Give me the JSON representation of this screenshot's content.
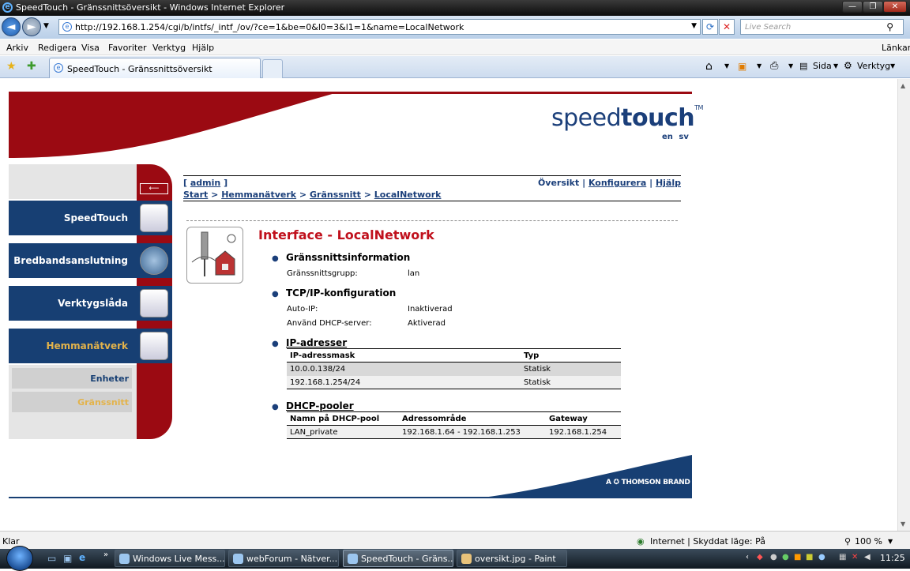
{
  "window": {
    "title": "SpeedTouch - Gränssnittsöversikt - Windows Internet Explorer",
    "minimize": "—",
    "restore": "❐",
    "close": "✕"
  },
  "browser": {
    "url": "http://192.168.1.254/cgi/b/intfs/_intf_/ov/?ce=1&be=0&l0=3&l1=1&name=LocalNetwork",
    "search_placeholder": "Live Search",
    "menu": [
      "Arkiv",
      "Redigera",
      "Visa",
      "Favoriter",
      "Verktyg",
      "Hjälp"
    ],
    "links_label": "Länkar",
    "tab_title": "SpeedTouch - Gränssnittsöversikt",
    "cmd_page": "Sida",
    "cmd_tools": "Verktyg"
  },
  "page": {
    "logo_light": "speed",
    "logo_bold": "touch",
    "logo_tm": "TM",
    "lang_en": "en",
    "lang_sv": "sv",
    "admin_link": "admin",
    "breadcrumb": [
      "Start",
      "Hemmanätverk",
      "Gränssnitt",
      "LocalNetwork"
    ],
    "right_links": [
      "Översikt",
      "Konfigurera",
      "Hjälp"
    ],
    "title": "Interface - LocalNetwork",
    "nav": [
      {
        "label": "SpeedTouch",
        "active": false
      },
      {
        "label": "Bredbandsanslutning",
        "active": false
      },
      {
        "label": "Verktygslåda",
        "active": false
      },
      {
        "label": "Hemmanätverk",
        "active": true
      }
    ],
    "subnav": [
      {
        "label": "Enheter",
        "active": false
      },
      {
        "label": "Gränssnitt",
        "active": true
      }
    ],
    "sections": {
      "info": {
        "heading": "Gränssnittsinformation",
        "rows": [
          {
            "key": "Gränssnittsgrupp:",
            "value": "lan"
          }
        ]
      },
      "tcpip": {
        "heading": "TCP/IP-konfiguration",
        "rows": [
          {
            "key": "Auto-IP:",
            "value": "Inaktiverad"
          },
          {
            "key": "Använd DHCP-server:",
            "value": "Aktiverad"
          }
        ]
      },
      "ip": {
        "heading": "IP-adresser",
        "columns": [
          "IP-adressmask",
          "Typ"
        ],
        "rows": [
          [
            "10.0.0.138/24",
            "Statisk"
          ],
          [
            "192.168.1.254/24",
            "Statisk"
          ]
        ]
      },
      "dhcp": {
        "heading": "DHCP-pooler",
        "columns": [
          "Namn på DHCP-pool",
          "Adressområde",
          "Gateway"
        ],
        "rows": [
          [
            "LAN_private",
            "192.168.1.64 - 192.168.1.253",
            "192.168.1.254"
          ]
        ]
      }
    },
    "footer_brand": "A ✪ THOMSON BRAND"
  },
  "status": {
    "left": "Klar",
    "zone": "Internet | Skyddat läge: På",
    "zoom": "100 %"
  },
  "taskbar": {
    "items": [
      {
        "label": "Windows Live Mess...",
        "active": false
      },
      {
        "label": "webForum - Nätver...",
        "active": false
      },
      {
        "label": "SpeedTouch - Gräns...",
        "active": true
      },
      {
        "label": "oversikt.jpg - Paint",
        "active": false
      }
    ],
    "clock": "11:25"
  },
  "colors": {
    "brand_blue": "#173f73",
    "brand_red": "#9b0a12",
    "title_red": "#c0101c",
    "active_gold": "#e3b34b"
  }
}
